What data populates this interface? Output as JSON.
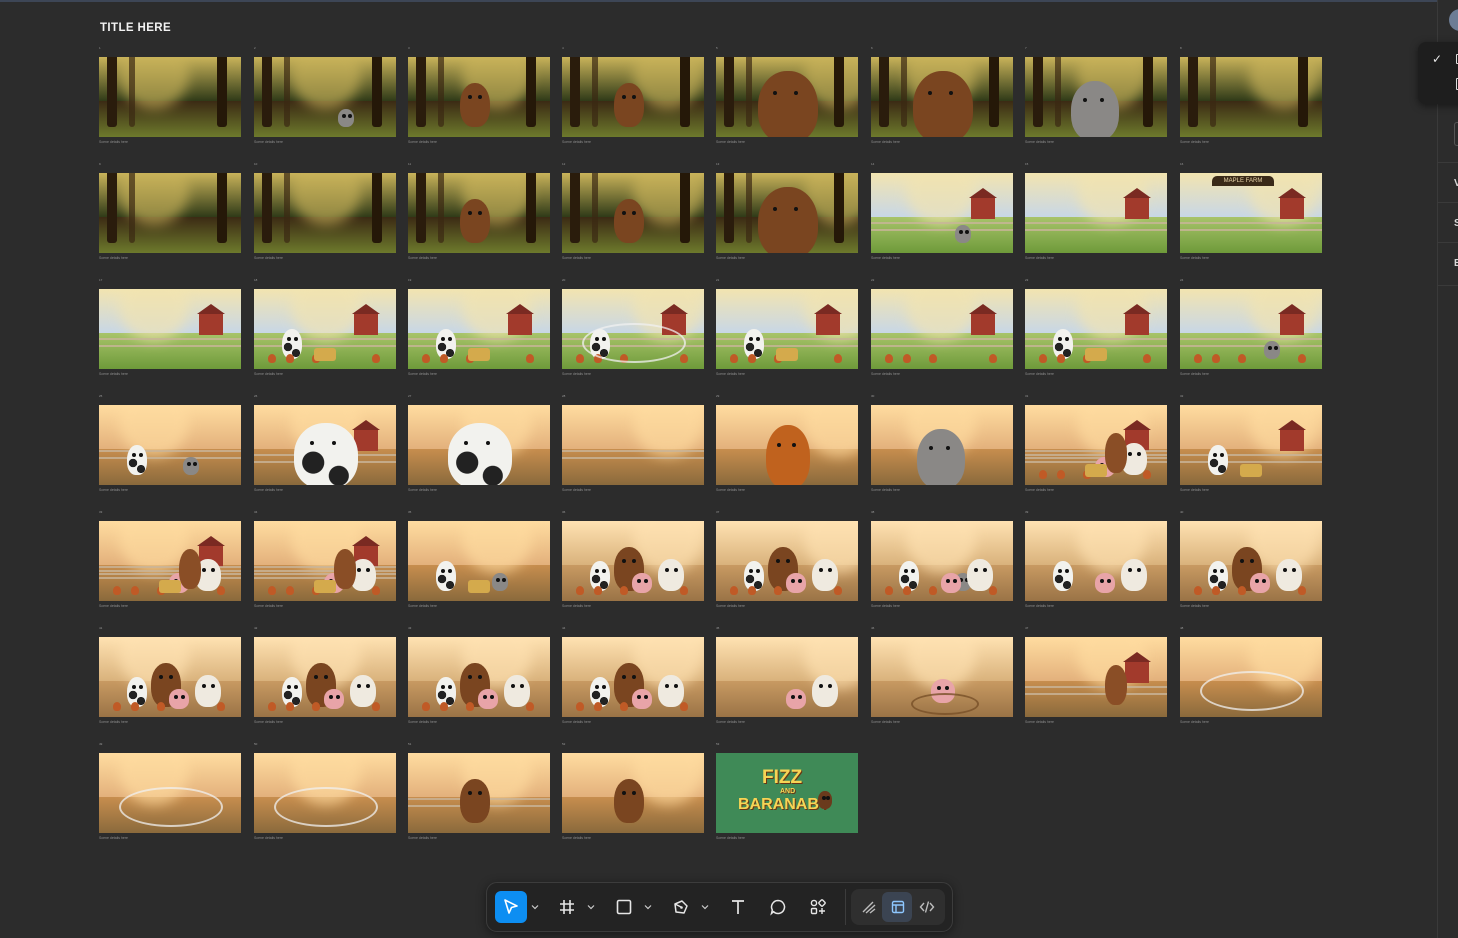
{
  "board": {
    "title": "TITLE HERE"
  },
  "caption_text": "Scene details here",
  "title_card": {
    "line1": "FIZZ",
    "line2": "AND",
    "line3": "BARANABY"
  },
  "farm_sign": "MAPLE FARM",
  "rows": [
    {
      "frames": [
        {
          "num": "1",
          "theme": "forest"
        },
        {
          "num": "2",
          "theme": "forest-mouse"
        },
        {
          "num": "3",
          "theme": "forest-bear"
        },
        {
          "num": "4",
          "theme": "forest-bear"
        },
        {
          "num": "5",
          "theme": "forest-bear-close"
        },
        {
          "num": "6",
          "theme": "forest-bear-close"
        },
        {
          "num": "7",
          "theme": "mouse-burst"
        },
        {
          "num": "8",
          "theme": "forest-bright"
        }
      ]
    },
    {
      "frames": [
        {
          "num": "9",
          "theme": "forest"
        },
        {
          "num": "10",
          "theme": "forest-path"
        },
        {
          "num": "11",
          "theme": "forest-bear"
        },
        {
          "num": "12",
          "theme": "forest-bear"
        },
        {
          "num": "13",
          "theme": "forest-bear-close"
        },
        {
          "num": "14",
          "theme": "mouse-farm"
        },
        {
          "num": "15",
          "theme": "farm-hills"
        },
        {
          "num": "16",
          "theme": "farm-gate"
        }
      ]
    },
    {
      "frames": [
        {
          "num": "17",
          "theme": "farm-yard"
        },
        {
          "num": "18",
          "theme": "farm-animals"
        },
        {
          "num": "19",
          "theme": "farm-animals"
        },
        {
          "num": "20",
          "theme": "farm-sparkle"
        },
        {
          "num": "21",
          "theme": "farm-animals"
        },
        {
          "num": "22",
          "theme": "coop"
        },
        {
          "num": "23",
          "theme": "farm-animals"
        },
        {
          "num": "24",
          "theme": "coop-mouse"
        }
      ]
    },
    {
      "frames": [
        {
          "num": "25",
          "theme": "cow-mouse"
        },
        {
          "num": "26",
          "theme": "cow-barn"
        },
        {
          "num": "27",
          "theme": "cow-close"
        },
        {
          "num": "28",
          "theme": "sunset-fence"
        },
        {
          "num": "29",
          "theme": "rooster"
        },
        {
          "num": "30",
          "theme": "mouse-close"
        },
        {
          "num": "31",
          "theme": "farm-sunset"
        },
        {
          "num": "32",
          "theme": "farm-animals-barn"
        }
      ]
    },
    {
      "frames": [
        {
          "num": "33",
          "theme": "farm-sunset"
        },
        {
          "num": "34",
          "theme": "farm-sunset"
        },
        {
          "num": "35",
          "theme": "cow-mouse-hay"
        },
        {
          "num": "36",
          "theme": "group"
        },
        {
          "num": "37",
          "theme": "group"
        },
        {
          "num": "38",
          "theme": "group-mouse"
        },
        {
          "num": "39",
          "theme": "cow-sheep"
        },
        {
          "num": "40",
          "theme": "group"
        }
      ]
    },
    {
      "frames": [
        {
          "num": "41",
          "theme": "group"
        },
        {
          "num": "42",
          "theme": "group"
        },
        {
          "num": "43",
          "theme": "group"
        },
        {
          "num": "44",
          "theme": "group"
        },
        {
          "num": "45",
          "theme": "sheep-dance"
        },
        {
          "num": "46",
          "theme": "pig-splash"
        },
        {
          "num": "47",
          "theme": "horse-barn"
        },
        {
          "num": "48",
          "theme": "ring"
        }
      ]
    },
    {
      "frames": [
        {
          "num": "49",
          "theme": "ring"
        },
        {
          "num": "50",
          "theme": "ring"
        },
        {
          "num": "51",
          "theme": "sunset-silhouette"
        },
        {
          "num": "52",
          "theme": "sunset-road"
        },
        {
          "num": "53",
          "theme": "title-card"
        }
      ]
    }
  ],
  "toolbar": {
    "tools": [
      "move-tool",
      "frame-tool",
      "shape-tool",
      "pen-tool",
      "text-tool",
      "comment-tool",
      "actions-tool"
    ],
    "modes": [
      "draw-mode",
      "design-mode",
      "dev-mode"
    ],
    "accent": "#0d8ef2"
  },
  "right_panel": {
    "letters": [
      "V",
      "S",
      "E"
    ]
  }
}
